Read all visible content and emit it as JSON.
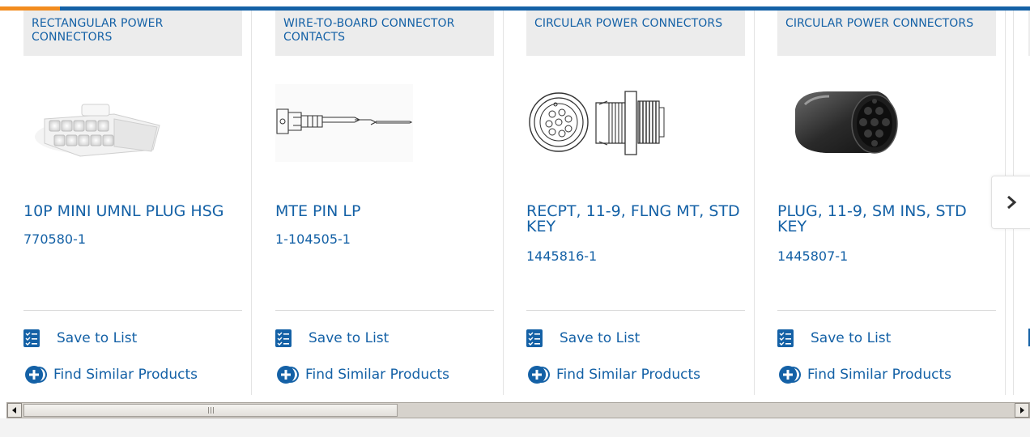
{
  "colors": {
    "brand_blue": "#1461a6",
    "accent_orange": "#f28c1f",
    "category_bg": "#ececec",
    "divider": "#d9d9d9"
  },
  "actions": {
    "save_label": "Save to List",
    "similar_label": "Find Similar Products",
    "save_icon": "checklist-icon",
    "similar_icon": "similar-products-icon"
  },
  "products": [
    {
      "category": "RECTANGULAR POWER CONNECTORS",
      "title": "10P MINI UMNL PLUG HSG",
      "part_number": "770580-1",
      "image": "rectangular-connector-image"
    },
    {
      "category": "WIRE-TO-BOARD CONNECTOR CONTACTS",
      "title": "MTE PIN LP",
      "part_number": "1-104505-1",
      "image": "pin-contact-image"
    },
    {
      "category": "CIRCULAR POWER CONNECTORS",
      "title": "RECPT, 11-9, FLNG MT, STD KEY",
      "part_number": "1445816-1",
      "image": "flange-receptacle-image"
    },
    {
      "category": "CIRCULAR POWER CONNECTORS",
      "title": "PLUG, 11-9, SM INS, STD KEY",
      "part_number": "1445807-1",
      "image": "circular-plug-image"
    }
  ],
  "carousel": {
    "next_icon": "chevron-right-icon"
  },
  "scrollbar": {
    "scroll_position_fraction": 0.0,
    "visible_fraction": 0.38
  }
}
